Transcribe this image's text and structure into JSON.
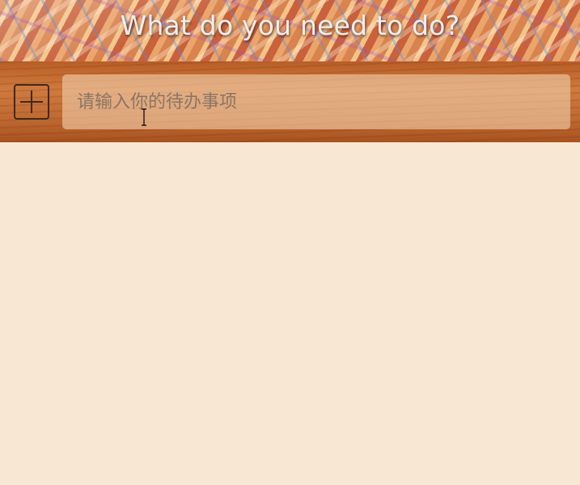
{
  "header": {
    "title": "What do you need to do?"
  },
  "input_bar": {
    "add_button_icon": "plus-square-icon",
    "todo_input_placeholder": "请输入你的待办事项",
    "todo_input_value": ""
  },
  "todo_list": {
    "items": []
  },
  "colors": {
    "page_background": "#f8e8d3",
    "title_text": "#eeeeee",
    "wood_bar": "#c06a32",
    "input_background": "#f0cdaa",
    "icon_stroke": "#3d2a1e"
  }
}
